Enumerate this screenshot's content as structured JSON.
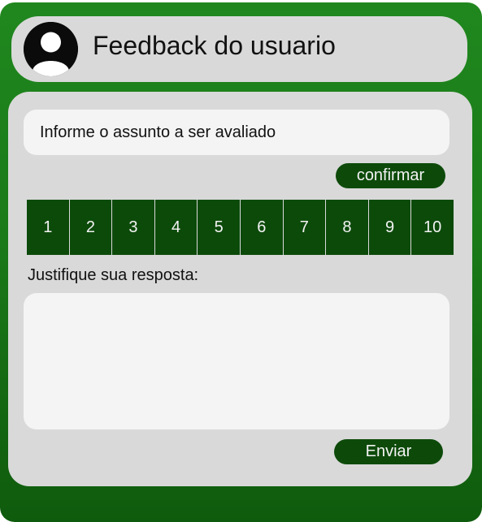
{
  "header": {
    "title": "Feedback do usuario",
    "avatar_icon": "user-avatar-icon"
  },
  "form": {
    "subject_placeholder": "Informe o assunto a ser avaliado",
    "confirm_label": "confirmar",
    "rating_options": [
      "1",
      "2",
      "3",
      "4",
      "5",
      "6",
      "7",
      "8",
      "9",
      "10"
    ],
    "justify_label": "Justifique sua resposta:",
    "justify_value": "",
    "send_label": "Enviar"
  },
  "colors": {
    "background_green": "#1a7a18",
    "button_dark_green": "#0d4a0a",
    "panel_gray": "#d9d9d9",
    "field_light": "#f4f4f4"
  }
}
